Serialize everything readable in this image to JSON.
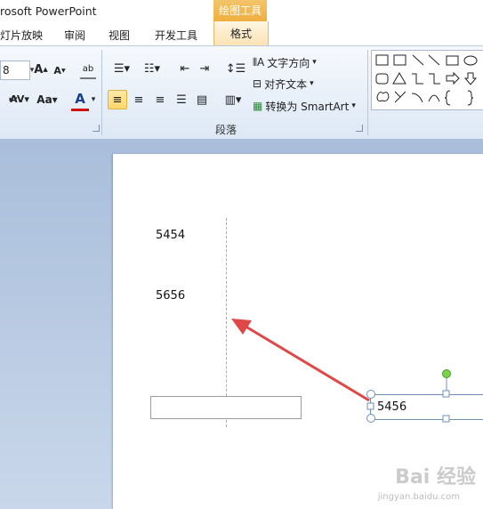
{
  "title": "rosoft PowerPoint",
  "context_tab_header": "绘图工具",
  "tabs": {
    "slideshow": "灯片放映",
    "review": "审阅",
    "view": "视图",
    "developer": "开发工具",
    "format": "格式"
  },
  "ribbon": {
    "font_size": "8",
    "case_label": "Aa",
    "text_direction": "文字方向",
    "align_text": "对齐文本",
    "convert_smartart": "转换为 SmartArt",
    "paragraph_group": "段落"
  },
  "slide": {
    "text1": "5454",
    "text2": "5656",
    "selected_text": "5456"
  },
  "watermark": {
    "logo": "Bai 经验",
    "url": "jingyan.baidu.com"
  },
  "colors": {
    "context_tab": "#efae3f",
    "active_button": "#ffd66b",
    "font_color_underline": "#d01010",
    "arrow": "#e04848",
    "rotate_handle": "#7bd34a"
  }
}
